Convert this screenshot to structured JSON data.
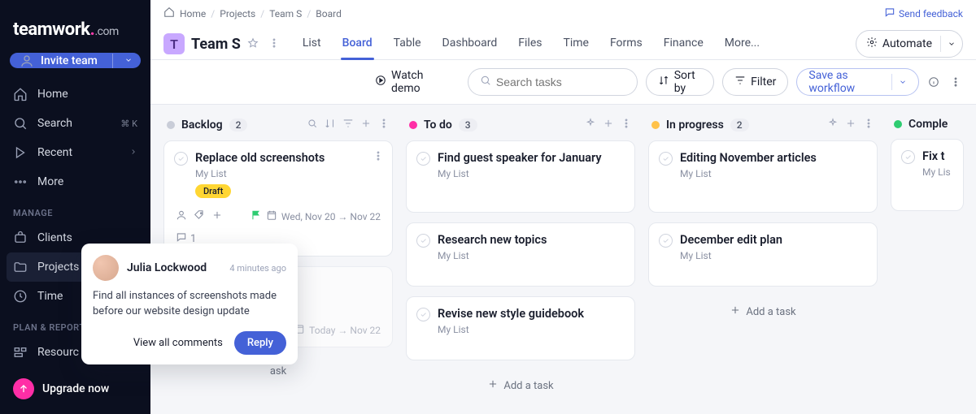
{
  "brand": {
    "name": "teamwork",
    "suffix": ".com"
  },
  "sidebar": {
    "invite_label": "Invite team",
    "nav": [
      {
        "icon": "home",
        "label": "Home"
      },
      {
        "icon": "search",
        "label": "Search",
        "shortcut": "⌘ K"
      },
      {
        "icon": "recent",
        "label": "Recent"
      },
      {
        "icon": "more",
        "label": "More"
      }
    ],
    "sections": {
      "manage": {
        "title": "MANAGE",
        "items": [
          {
            "icon": "clients",
            "label": "Clients"
          },
          {
            "icon": "projects",
            "label": "Projects",
            "active": true
          },
          {
            "icon": "time",
            "label": "Time"
          }
        ]
      },
      "plan": {
        "title": "PLAN & REPORT",
        "items": [
          {
            "icon": "resource",
            "label": "Resourc"
          }
        ]
      }
    },
    "upgrade_label": "Upgrade now"
  },
  "breadcrumbs": [
    "Home",
    "Projects",
    "Team S",
    "Board"
  ],
  "feedback_label": "Send feedback",
  "project": {
    "initial": "T",
    "name": "Team S"
  },
  "tabs": [
    "List",
    "Board",
    "Table",
    "Dashboard",
    "Files",
    "Time",
    "Forms",
    "Finance",
    "More..."
  ],
  "active_tab": "Board",
  "automate_label": "Automate",
  "toolbar": {
    "watch_demo": "Watch demo",
    "search_placeholder": "Search tasks",
    "sort_label": "Sort by",
    "filter_label": "Filter",
    "save_workflow": "Save as workflow"
  },
  "columns": [
    {
      "name": "Backlog",
      "color": "#c9cdd8",
      "count": "2",
      "head_actions": [
        "search",
        "sort",
        "filter",
        "plus",
        "dots"
      ],
      "cards": [
        {
          "title": "Replace old screenshots",
          "list": "My List",
          "tag": "Draft",
          "meta": {
            "assign": true,
            "tagi": true,
            "plus": true,
            "flag": true,
            "dates": "Wed, Nov 20 → Nov 22"
          },
          "comments": "1",
          "more": true
        },
        {
          "title": "",
          "list": "",
          "partial": true,
          "meta": {
            "dates": "Today → Nov 22"
          }
        }
      ],
      "add_label": "ask"
    },
    {
      "name": "To do",
      "color": "#ff2ea6",
      "count": "3",
      "head_actions": [
        "sparkle",
        "plus",
        "dots"
      ],
      "cards": [
        {
          "title": "Find guest speaker for January",
          "list": "My List"
        },
        {
          "title": "Research new topics",
          "list": "My List"
        },
        {
          "title": "Revise new style guidebook",
          "list": "My List"
        }
      ],
      "add_label": "Add a task"
    },
    {
      "name": "In progress",
      "color": "#ffc24a",
      "count": "2",
      "head_actions": [
        "sparkle",
        "plus",
        "dots"
      ],
      "cards": [
        {
          "title": "Editing November articles",
          "list": "My List"
        },
        {
          "title": "December edit plan",
          "list": "My List"
        }
      ],
      "add_label": "Add a task"
    },
    {
      "name": "Comple",
      "color": "#2ecc71",
      "count": "",
      "head_actions": [],
      "cards": [
        {
          "title": "Fix t",
          "list": "My Lis"
        }
      ]
    }
  ],
  "popover": {
    "name": "Julia Lockwood",
    "time": "4 minutes ago",
    "body": "Find all instances of screenshots made before our website design update",
    "view_all": "View all comments",
    "reply": "Reply"
  }
}
